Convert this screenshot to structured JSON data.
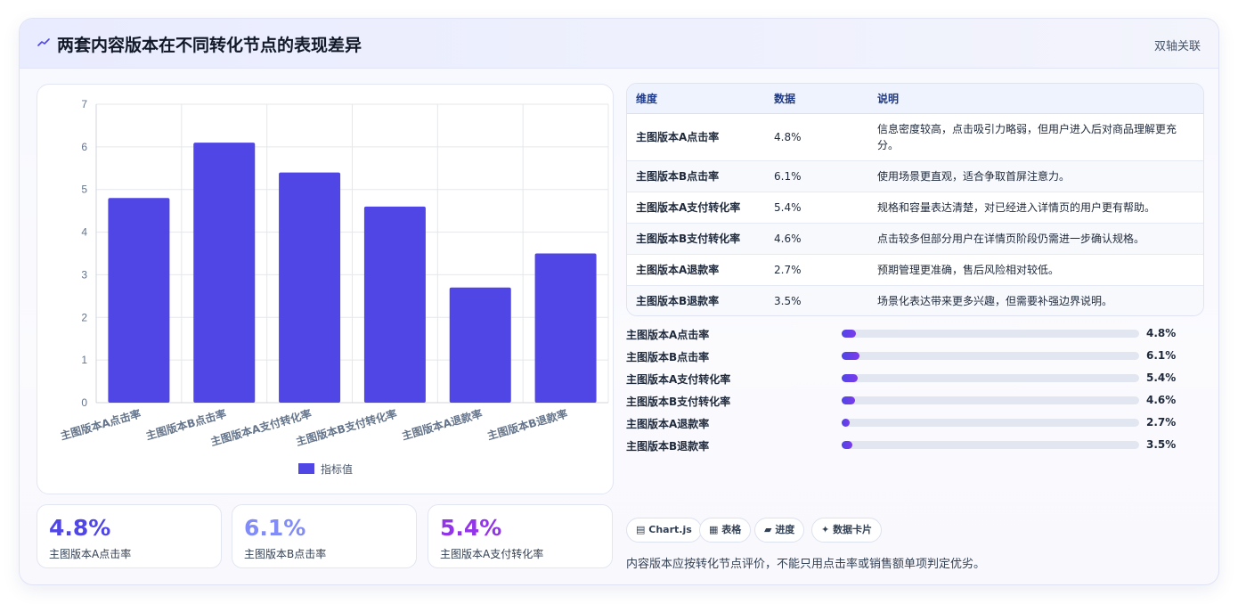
{
  "header": {
    "title": "两套内容版本在不同转化节点的表现差异",
    "icon": "trend-line-icon",
    "badge": "双轴关联"
  },
  "chart_data": {
    "type": "bar",
    "categories": [
      "主图版本A点击率",
      "主图版本B点击率",
      "主图版本A支付转化率",
      "主图版本B支付转化率",
      "主图版本A退款率",
      "主图版本B退款率"
    ],
    "series": [
      {
        "name": "指标值",
        "values": [
          4.8,
          6.1,
          5.4,
          4.6,
          2.7,
          3.5
        ],
        "color": "#4f46e5"
      }
    ],
    "ylim": [
      0,
      7
    ],
    "yticks": [
      0,
      1,
      2,
      3,
      4,
      5,
      6,
      7
    ],
    "grid": true,
    "legend_position": "bottom"
  },
  "table": {
    "headers": [
      "维度",
      "数据",
      "说明"
    ],
    "rows": [
      [
        "主图版本A点击率",
        "4.8%",
        "信息密度较高，点击吸引力略弱，但用户进入后对商品理解更充分。"
      ],
      [
        "主图版本B点击率",
        "6.1%",
        "使用场景更直观，适合争取首屏注意力。"
      ],
      [
        "主图版本A支付转化率",
        "5.4%",
        "规格和容量表达清楚，对已经进入详情页的用户更有帮助。"
      ],
      [
        "主图版本B支付转化率",
        "4.6%",
        "点击较多但部分用户在详情页阶段仍需进一步确认规格。"
      ],
      [
        "主图版本A退款率",
        "2.7%",
        "预期管理更准确，售后风险相对较低。"
      ],
      [
        "主图版本B退款率",
        "3.5%",
        "场景化表达带来更多兴趣，但需要补强边界说明。"
      ]
    ]
  },
  "progress": [
    {
      "label": "主图版本A点击率",
      "value": "4.8%",
      "fraction": 0.048
    },
    {
      "label": "主图版本B点击率",
      "value": "6.1%",
      "fraction": 0.061
    },
    {
      "label": "主图版本A支付转化率",
      "value": "5.4%",
      "fraction": 0.054
    },
    {
      "label": "主图版本B支付转化率",
      "value": "4.6%",
      "fraction": 0.046
    },
    {
      "label": "主图版本A退款率",
      "value": "2.7%",
      "fraction": 0.027
    },
    {
      "label": "主图版本B退款率",
      "value": "3.5%",
      "fraction": 0.035
    }
  ],
  "kpis": [
    {
      "value": "4.8%",
      "label": "主图版本A点击率",
      "color": "#4f46e5"
    },
    {
      "value": "6.1%",
      "label": "主图版本B点击率",
      "color": "#818cf8"
    },
    {
      "value": "5.4%",
      "label": "主图版本A支付转化率",
      "color": "#9333ea"
    }
  ],
  "chips": [
    {
      "icon": "▤",
      "label": "Chart.js"
    },
    {
      "icon": "▦",
      "label": "表格"
    },
    {
      "icon": "▰",
      "label": "进度"
    },
    {
      "icon": "✦",
      "label": "数据卡片"
    }
  ],
  "note": "内容版本应按转化节点评价，不能只用点击率或销售额单项判定优劣。"
}
